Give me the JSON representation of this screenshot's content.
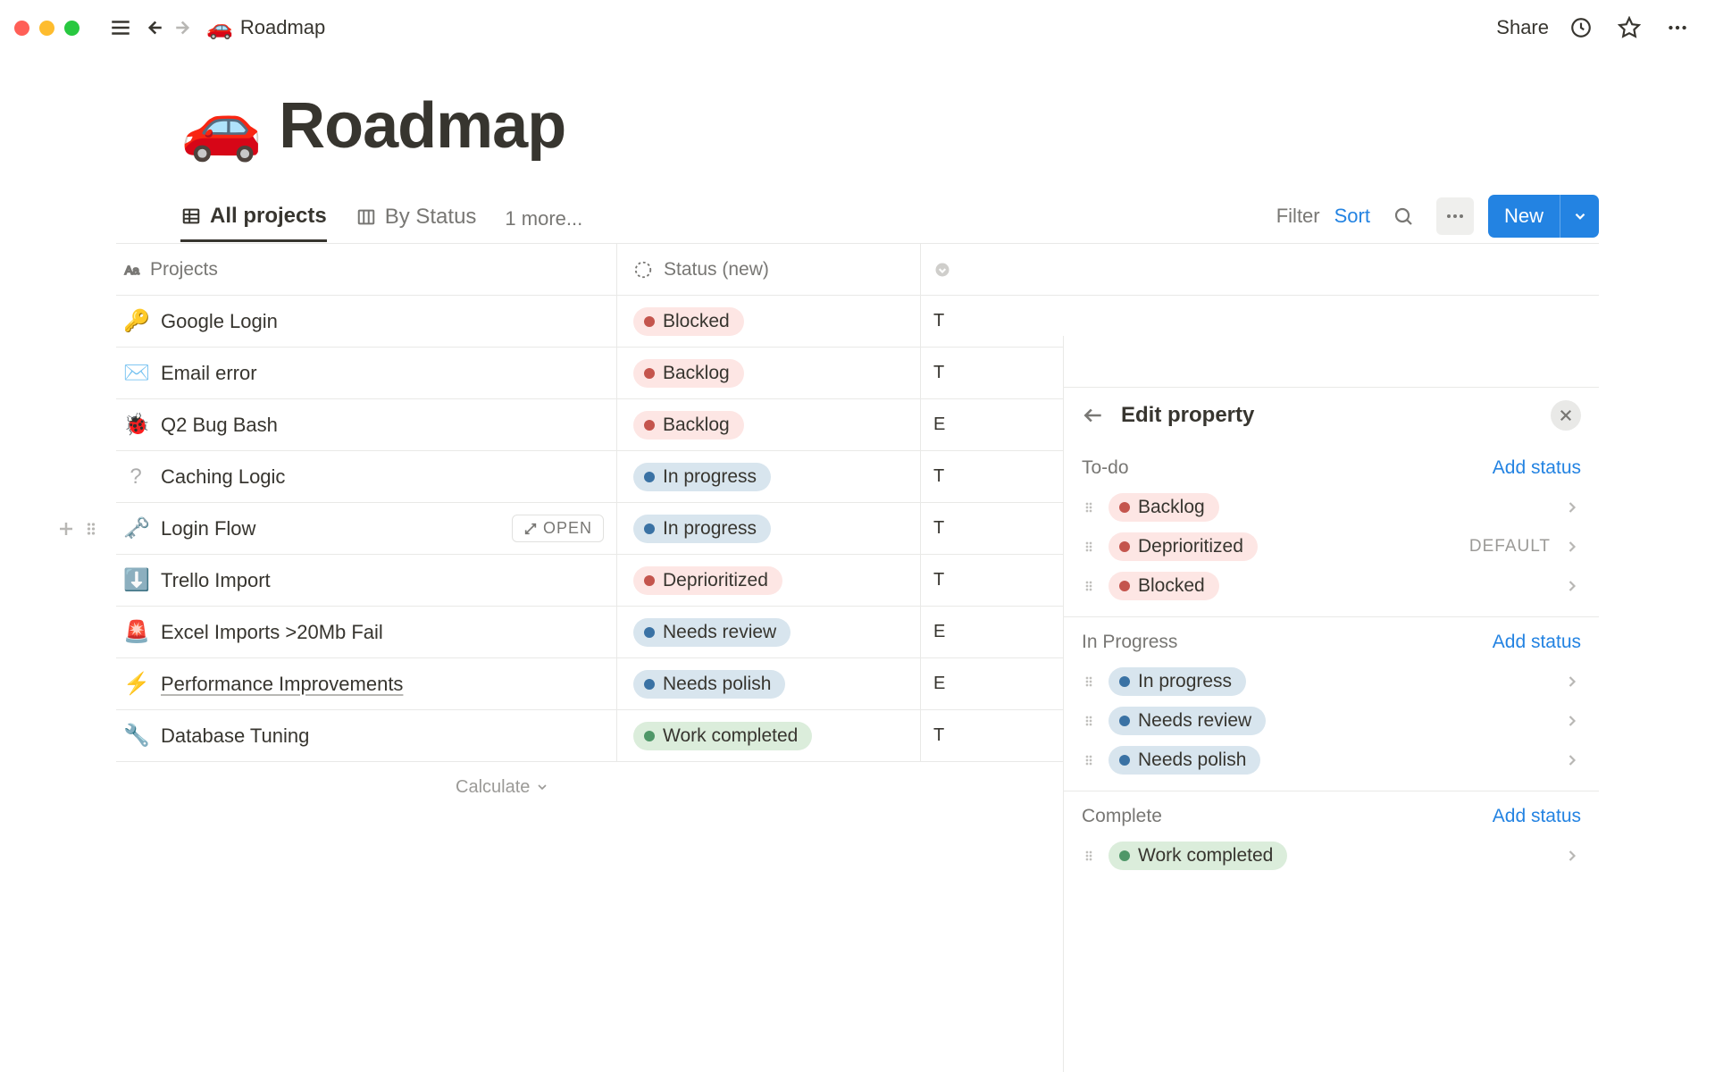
{
  "topbar": {
    "breadcrumb_emoji": "🚗",
    "breadcrumb_title": "Roadmap",
    "share_label": "Share"
  },
  "page": {
    "title_emoji": "🚗",
    "title": "Roadmap"
  },
  "tabs": {
    "all_projects": "All projects",
    "by_status": "By Status",
    "more": "1 more..."
  },
  "controls": {
    "filter": "Filter",
    "sort": "Sort",
    "new": "New"
  },
  "columns": {
    "projects": "Projects",
    "status": "Status (new)"
  },
  "rows": [
    {
      "emoji": "🔑",
      "name": "Google Login",
      "status": "Blocked",
      "color": "red",
      "extra": "T",
      "faded": false,
      "under": false
    },
    {
      "emoji": "✉️",
      "name": "Email error",
      "status": "Backlog",
      "color": "red",
      "extra": "T",
      "faded": false,
      "under": false
    },
    {
      "emoji": "🐞",
      "name": "Q2 Bug Bash",
      "status": "Backlog",
      "color": "red",
      "extra": "E",
      "faded": false,
      "under": false
    },
    {
      "emoji": "?",
      "name": "Caching Logic",
      "status": "In progress",
      "color": "blue",
      "extra": "T",
      "faded": true,
      "under": false
    },
    {
      "emoji": "🗝️",
      "name": "Login Flow",
      "status": "In progress",
      "color": "blue",
      "extra": "T",
      "faded": false,
      "under": false,
      "open": true,
      "handles": true
    },
    {
      "emoji": "⬇️",
      "name": "Trello Import",
      "status": "Deprioritized",
      "color": "red",
      "extra": "T",
      "faded": false,
      "under": false
    },
    {
      "emoji": "🚨",
      "name": "Excel Imports >20Mb Fail",
      "status": "Needs review",
      "color": "blue",
      "extra": "E",
      "faded": false,
      "under": false
    },
    {
      "emoji": "⚡",
      "name": "Performance Improvements",
      "status": "Needs polish",
      "color": "blue",
      "extra": "E",
      "faded": false,
      "under": true
    },
    {
      "emoji": "🔧",
      "name": "Database Tuning",
      "status": "Work completed",
      "color": "green",
      "extra": "T",
      "faded": false,
      "under": false
    }
  ],
  "open_btn": "OPEN",
  "calculate": "Calculate",
  "panel": {
    "title": "Edit property",
    "groups": [
      {
        "label": "To-do",
        "add": "Add status",
        "items": [
          {
            "text": "Backlog",
            "color": "red",
            "default": false
          },
          {
            "text": "Deprioritized",
            "color": "red",
            "default": true
          },
          {
            "text": "Blocked",
            "color": "red",
            "default": false
          }
        ]
      },
      {
        "label": "In Progress",
        "add": "Add status",
        "items": [
          {
            "text": "In progress",
            "color": "blue",
            "default": false
          },
          {
            "text": "Needs review",
            "color": "blue",
            "default": false
          },
          {
            "text": "Needs polish",
            "color": "blue",
            "default": false
          }
        ]
      },
      {
        "label": "Complete",
        "add": "Add status",
        "items": [
          {
            "text": "Work completed",
            "color": "green",
            "default": false
          }
        ]
      }
    ],
    "default_label": "DEFAULT"
  }
}
